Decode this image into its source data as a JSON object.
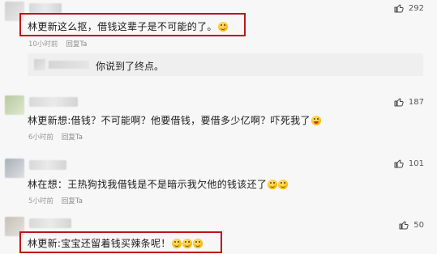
{
  "comments": [
    {
      "text": "林更新这么抠，借钱这辈子是不可能的了。",
      "time": "10小时前",
      "reply": "回复Ta",
      "likes": "292",
      "emoji": "face-emoji",
      "highlighted": true
    },
    {
      "text": "林更新想:借钱？不可能啊？他要借钱，要借多少亿啊？吓死我了",
      "time": "6小时前",
      "reply": "回复Ta",
      "likes": "187",
      "emoji": "laughing-emoji",
      "highlighted": false
    },
    {
      "text": "林在想：王热狗找我借钱是不是暗示我欠他的钱该还了",
      "time": "5小时前",
      "reply": "回复Ta",
      "likes": "101",
      "emoji": "smile-emoji",
      "highlighted": false
    },
    {
      "text": "林更新:宝宝还留着钱买辣条呢！",
      "time": "",
      "reply": "",
      "likes": "50",
      "emoji": "smile-emoji",
      "highlighted": true
    }
  ],
  "nested_reply": {
    "text": "你说到了终点。"
  },
  "colors": {
    "highlight": "#c0121b",
    "background": "#f7f7f7"
  }
}
